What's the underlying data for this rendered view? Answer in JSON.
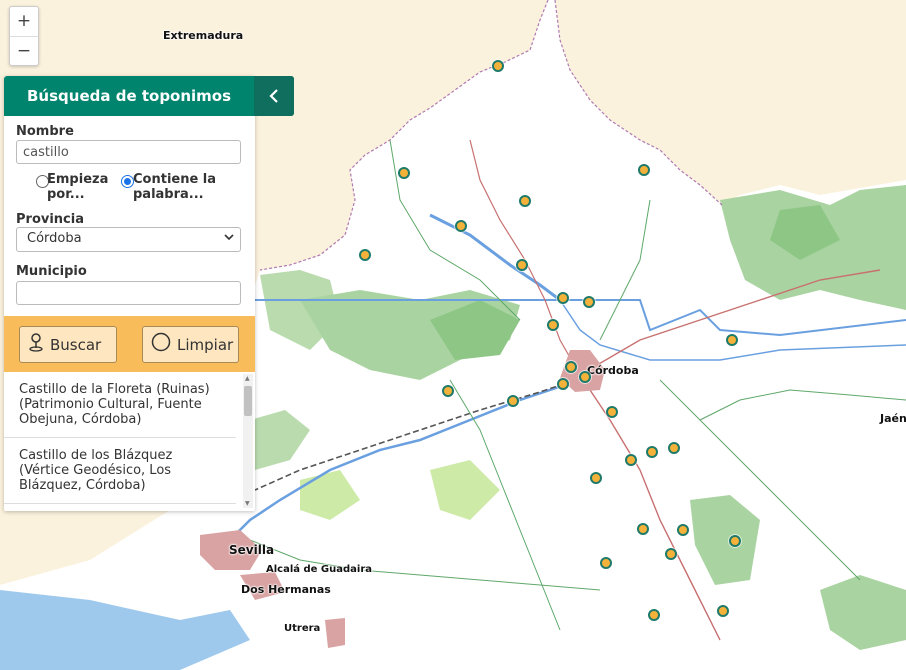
{
  "map": {
    "places": [
      {
        "name": "Extremadura",
        "size": "mid"
      },
      {
        "name": "Córdoba",
        "size": "mid"
      },
      {
        "name": "Sevilla",
        "size": "big"
      },
      {
        "name": "Alcalá de Guadaira",
        "size": "small"
      },
      {
        "name": "Dos Hermanas",
        "size": "mid"
      },
      {
        "name": "Utrera",
        "size": "small"
      },
      {
        "name": "Jaén",
        "size": "mid"
      }
    ],
    "marker_color": "#f4b23a",
    "marker_border_color": "#1f7a6a",
    "land_color": "#ffffff",
    "outside_region_color": "#fbf2dd",
    "forest_color": "#a9d3a0",
    "water_color": "#8ec5ea",
    "urban_color": "#d9a3a3"
  },
  "zoom": {
    "in_label": "+",
    "out_label": "−"
  },
  "panel": {
    "title": "Búsqueda de toponimos",
    "collapse_icon": "chevron-left-icon",
    "nombre_label": "Nombre",
    "nombre_value": "castillo",
    "radio_begins_label": "Empieza por...",
    "radio_contains_label": "Contiene la palabra...",
    "radio_selected": "contains",
    "provincia_label": "Provincia",
    "provincia_value": "Córdoba",
    "municipio_label": "Municipio",
    "municipio_value": "",
    "buscar_label": "Buscar",
    "limpiar_label": "Limpiar",
    "results": [
      "Castillo de la Floreta (Ruinas) (Patrimonio Cultural, Fuente Obejuna, Córdoba)",
      "Castillo de los Blázquez (Vértice Geodésico, Los Blázquez, Córdoba)"
    ]
  },
  "colors": {
    "header": "#00846d",
    "header_dark": "#0f6e5e",
    "action_bar": "#f9bc5a"
  }
}
